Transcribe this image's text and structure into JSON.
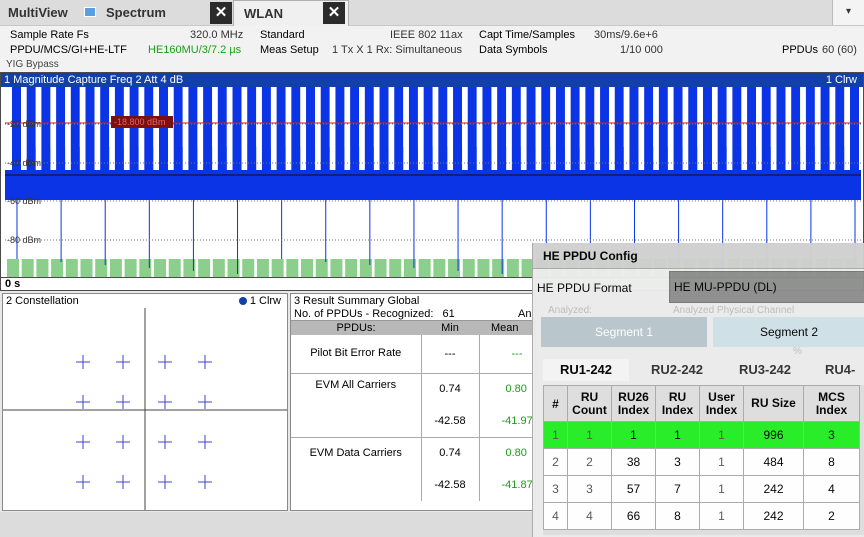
{
  "tabs": {
    "multiview": "MultiView",
    "spectrum": "Spectrum",
    "wlan": "WLAN",
    "close_symbol": "✕",
    "dropdown_symbol": "▾"
  },
  "info": {
    "sample_rate_label": "Sample Rate Fs",
    "sample_rate_value": "320.0 MHz",
    "standard_label": "Standard",
    "standard_value": "IEEE 802 11ax",
    "capt_label": "Capt Time/Samples",
    "capt_value": "30ms/9.6e+6",
    "ppdu_label": "PPDU/MCS/GI+HE-LTF",
    "ppdu_value": "HE160MU/3/7.2 µs",
    "meas_label": "Meas Setup",
    "meas_value": "1 Tx X 1 Rx: Simultaneous",
    "symbols_label": "Data Symbols",
    "symbols_value": "1/10 000",
    "ppdus_label": "PPDUs",
    "ppdus_value": "60 (60)",
    "yig": "YIG Bypass"
  },
  "magnitude": {
    "title": "1 Magnitude Capture  Freq 2  Att 4 dB",
    "trace": "1 Clrw",
    "marker_label": "-18.800 dBm",
    "y_ticks": [
      "-20 dBm",
      "-40 dBm",
      "-60 dBm",
      "-80 dBm"
    ],
    "x_start": "0 s"
  },
  "constellation": {
    "title": "2 Constellation",
    "trace": "1 Clrw"
  },
  "summary": {
    "title": "3 Result Summary Global",
    "recognized_label": "No. of PPDUs - Recognized:",
    "recognized_value": "61",
    "analyzed_partial": "An",
    "col_ppdus": "PPDUs:",
    "col_min": "Min",
    "col_mean": "Mean",
    "rows": [
      {
        "name": "Pilot Bit Error Rate",
        "min": "---",
        "mean": "---"
      },
      {
        "name": "EVM All Carriers",
        "min": "0.74",
        "mean": "0.80",
        "min2": "-42.58",
        "mean2": "-41.97"
      },
      {
        "name": "EVM Data Carriers",
        "min": "0.74",
        "mean": "0.80",
        "min2": "-42.58",
        "mean2": "-41.87"
      }
    ]
  },
  "he": {
    "title": "HE PPDU Config",
    "format_label": "HE PPDU Format",
    "format_value": "HE MU-PPDU (DL)",
    "segment1": "Segment 1",
    "segment2": "Segment 2",
    "ghost_analyzed": "Analyzed:",
    "ghost_physical": "Analyzed Physical Channel",
    "ghost_pct": "%",
    "ru_tabs": [
      "RU1-242",
      "RU2-242",
      "RU3-242",
      "RU4-"
    ],
    "columns": [
      "#",
      "RU Count",
      "RU26 Index",
      "RU Index",
      "User Index",
      "RU Size",
      "MCS Index"
    ],
    "rows": [
      [
        "1",
        "1",
        "1",
        "1",
        "1",
        "996",
        "3"
      ],
      [
        "2",
        "2",
        "38",
        "3",
        "1",
        "484",
        "8"
      ],
      [
        "3",
        "3",
        "57",
        "7",
        "1",
        "242",
        "4"
      ],
      [
        "4",
        "4",
        "66",
        "8",
        "1",
        "242",
        "2"
      ]
    ]
  },
  "colors": {
    "accent": "#123fa8",
    "trace": "#0a34e6",
    "marker": "#c82020",
    "highlight": "#22ee22",
    "preamble": "#8ccf8c"
  }
}
